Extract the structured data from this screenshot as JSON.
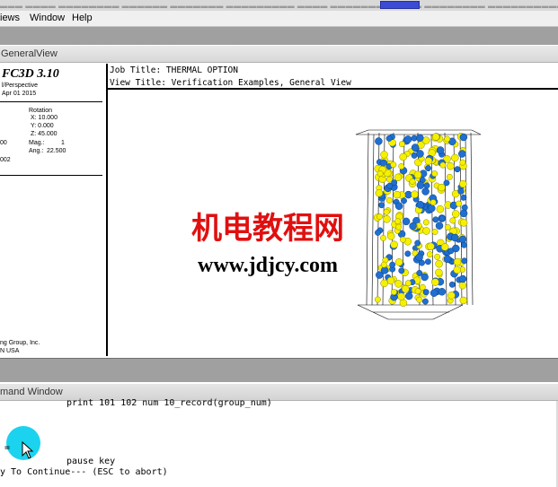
{
  "menu": {
    "items": [
      "iews",
      "Window",
      "Help"
    ]
  },
  "view_tab": {
    "label": "GeneralView"
  },
  "info_panel": {
    "product": "FC3D 3.10",
    "perspective": "l/Perspective",
    "date": "Apr 01 2015",
    "rotation_label": "Rotation",
    "rot_x": "X:  10.000",
    "rot_y": "Y:   0.000",
    "rot_z": "Z:  45.000",
    "mag_label": "Mag.:",
    "mag_value": "1",
    "ang_label": "Ang.:",
    "ang_value": "22.500",
    "left_frag1": "00",
    "left_frag2": "002",
    "company": "ng Group, Inc.",
    "location": "N   USA"
  },
  "header": {
    "job_title": "Job Title: THERMAL OPTION",
    "view_title": "View Title: Verification Examples, General View"
  },
  "watermark": {
    "chinese": "机电教程网",
    "url": "www.jdjcy.com"
  },
  "command_window": {
    "title": "mand Window",
    "line1": "print 101 102 num 10_record(group_num)",
    "line2": "pause key",
    "prompt_fragment": "= ",
    "line3": "y To Continue--- (ESC to abort)"
  },
  "colors": {
    "ball_yellow": "#f5f000",
    "ball_blue": "#1f6fd1",
    "watermark_red": "#e01010",
    "cursor_highlight": "#1bd3ee"
  }
}
